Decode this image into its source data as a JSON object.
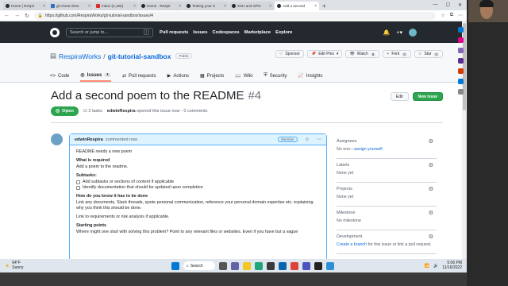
{
  "tabs": [
    {
      "label": "Home | Respir",
      "type": "gh"
    },
    {
      "label": "git cheat shee",
      "type": "dv"
    },
    {
      "label": "Inbox (2,180)",
      "type": "gm"
    },
    {
      "label": "Home · Respir",
      "type": "gh"
    },
    {
      "label": "Testing your S",
      "type": "gh"
    },
    {
      "label": "SSH and GPG",
      "type": "gh"
    },
    {
      "label": "Add a second",
      "type": "gh",
      "active": true
    }
  ],
  "address": {
    "url": "https://github.com/RespiraWorks/git-tutorial-sandbox/issues/4"
  },
  "github": {
    "search_placeholder": "Search or jump to...",
    "search_key": "/",
    "nav": [
      "Pull requests",
      "Issues",
      "Codespaces",
      "Marketplace",
      "Explore"
    ]
  },
  "repo": {
    "owner": "RespiraWorks",
    "sep": "/",
    "name": "git-tutorial-sandbox",
    "visibility": "Public",
    "actions": [
      {
        "label": "Sponsor"
      },
      {
        "label": "Edit Pins",
        "caret": "▾"
      },
      {
        "label": "Watch",
        "count": "5"
      },
      {
        "label": "Fork",
        "count": "0"
      },
      {
        "label": "Star",
        "count": "0"
      }
    ],
    "tabs": [
      {
        "label": "Code",
        "icon": "<>"
      },
      {
        "label": "Issues",
        "icon": "◎",
        "count": "1",
        "selected": true
      },
      {
        "label": "Pull requests",
        "icon": "⇄"
      },
      {
        "label": "Actions",
        "icon": "▶"
      },
      {
        "label": "Projects",
        "icon": "▦"
      },
      {
        "label": "Wiki",
        "icon": "📖"
      },
      {
        "label": "Security",
        "icon": "⛨"
      },
      {
        "label": "Insights",
        "icon": "📈"
      }
    ]
  },
  "issue": {
    "title": "Add a second poem to the README",
    "number": "#4",
    "edit_label": "Edit",
    "new_issue_label": "New issue",
    "status": "Open",
    "tasks": "2 tasks",
    "author": "edwinRespira",
    "meta_text": "opened this issue now · 0 comments"
  },
  "comment": {
    "author": "edwinRespira",
    "time": "commented now",
    "role": "Member",
    "intro": "README needs a new poem",
    "what_h": "What is required",
    "what_t": "Add a poem to the readme.",
    "sub_h": "Subtasks:",
    "tasks": [
      "Add subtasks or sections of content if applicable",
      "Identify documentation that should be updated upon completion"
    ],
    "how_h": "How do you know it has to be done",
    "how_t": "Link any documents, Slack threads, quote personal communication, reference your personal domain expertise etc. explaining why you think this should be done.",
    "link_t": "Link to requirements or risk analysis if applicable.",
    "start_h": "Starting points",
    "start_t": "Where might one start with solving this problem? Point to any relevant files or websites. Even if you have but a vague"
  },
  "sidebar": [
    {
      "title": "Assignees",
      "value": "No one—",
      "link": "assign yourself"
    },
    {
      "title": "Labels",
      "value": "None yet"
    },
    {
      "title": "Projects",
      "value": "None yet"
    },
    {
      "title": "Milestone",
      "value": "No milestone"
    },
    {
      "title": "Development",
      "value": "for this issue or link a pull request.",
      "link": "Create a branch"
    }
  ],
  "taskbar": {
    "temp": "64°F",
    "weather": "Sunny",
    "search": "Search",
    "time": "5:06 PM",
    "date": "11/16/2022"
  },
  "colors": {
    "gh_header": "#24292f",
    "open_green": "#2da44e",
    "link_blue": "#0969da"
  }
}
